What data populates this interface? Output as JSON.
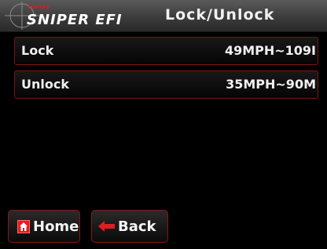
{
  "header": {
    "brand_top": "Holley",
    "brand_main": "SNIPER EFI",
    "title": "Lock/Unlock"
  },
  "rows": [
    {
      "label": "Lock",
      "value": "49MPH~109I"
    },
    {
      "label": "Unlock",
      "value": "35MPH~90M"
    }
  ],
  "footer": {
    "home_label": "Home",
    "back_label": "Back"
  },
  "colors": {
    "accent": "#e21c22",
    "border": "#7a1414",
    "background": "#000000"
  }
}
